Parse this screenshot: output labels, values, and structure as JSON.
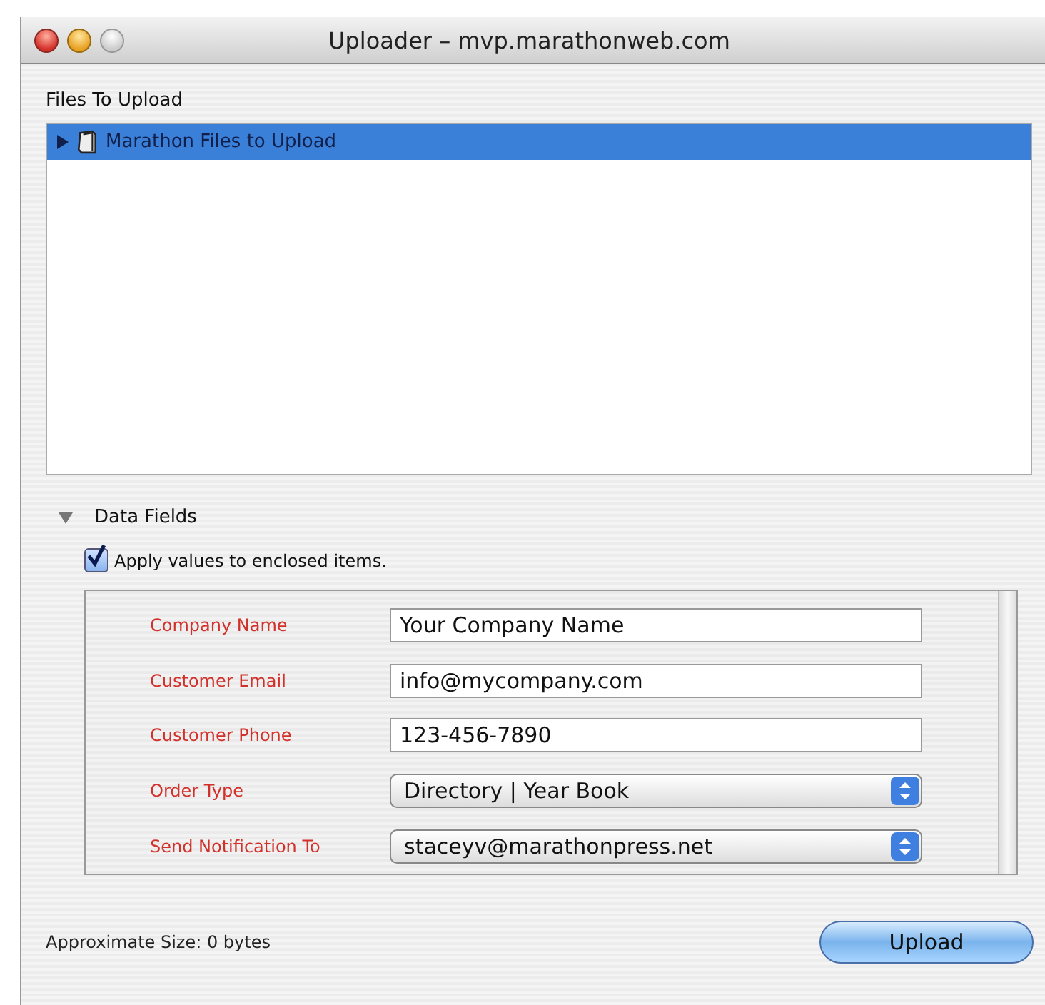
{
  "window": {
    "title": "Uploader – mvp.marathonweb.com"
  },
  "files": {
    "label": "Files To Upload",
    "items": [
      {
        "name": "Marathon Files to Upload",
        "selected": true,
        "expanded": false
      }
    ]
  },
  "data_fields": {
    "label": "Data Fields",
    "expanded": true,
    "apply": {
      "label": "Apply values to enclosed items.",
      "checked": true
    },
    "fields": [
      {
        "label": "Company Name",
        "kind": "text",
        "value": "Your Company Name"
      },
      {
        "label": "Customer Email",
        "kind": "text",
        "value": "info@mycompany.com"
      },
      {
        "label": "Customer Phone",
        "kind": "text",
        "value": "123-456-7890"
      },
      {
        "label": "Order Type",
        "kind": "popup",
        "value": "Directory | Year Book"
      },
      {
        "label": "Send Notification To",
        "kind": "popup",
        "value": "staceyv@marathonpress.net"
      }
    ]
  },
  "status": "Approximate Size: 0 bytes",
  "buttons": [
    "Upload"
  ]
}
